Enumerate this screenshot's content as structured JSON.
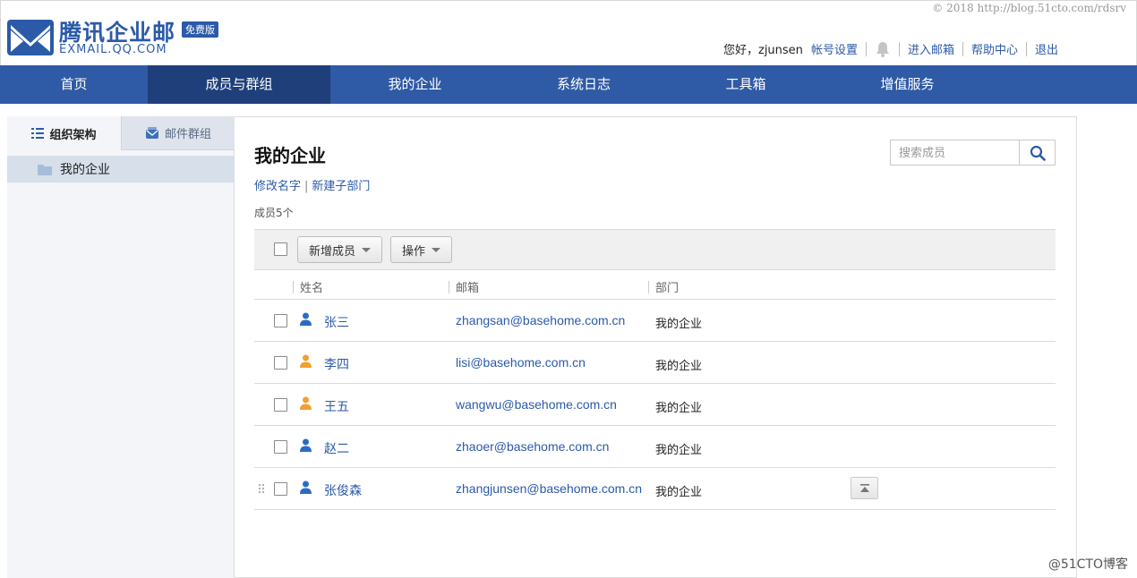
{
  "watermark_top": "© 2018 http://blog.51cto.com/rdsrv",
  "watermark_bottom": "@51CTO博客",
  "brand": {
    "title": "腾讯企业邮",
    "subtitle": "EXMAIL.QQ.COM",
    "badge": "免费版",
    "color": "#2b5aa8"
  },
  "user_bar": {
    "greeting": "您好，zjunsen",
    "account_settings": "帐号设置",
    "enter_mailbox": "进入邮箱",
    "help": "帮助中心",
    "logout": "退出"
  },
  "nav": {
    "items": [
      {
        "label": "首页"
      },
      {
        "label": "成员与群组",
        "active": true
      },
      {
        "label": "我的企业"
      },
      {
        "label": "系统日志"
      },
      {
        "label": "工具箱"
      },
      {
        "label": "增值服务"
      }
    ],
    "color": "#2f5aa5",
    "active_color": "#1e3f7a"
  },
  "sidebar": {
    "tabs": [
      {
        "label": "组织架构",
        "icon": "list-icon",
        "active": true
      },
      {
        "label": "邮件群组",
        "icon": "mail-group-icon",
        "active": false
      }
    ],
    "tree": [
      {
        "label": "我的企业",
        "icon": "folder-icon",
        "selected": true
      }
    ]
  },
  "main": {
    "title": "我的企业",
    "rename": "修改名字",
    "separator": "|",
    "new_sub_department": "新建子部门",
    "member_count": "成员5个",
    "search": {
      "placeholder": "搜索成员",
      "value": ""
    },
    "toolbar": {
      "add_member": "新增成员",
      "operations": "操作"
    },
    "table": {
      "headers": {
        "name": "姓名",
        "email": "邮箱",
        "department": "部门"
      },
      "rows": [
        {
          "name": "张三",
          "email": "zhangsan@basehome.com.cn",
          "department": "我的企业",
          "icon_color": "#2b6cc4"
        },
        {
          "name": "李四",
          "email": "lisi@basehome.com.cn",
          "department": "我的企业",
          "icon_color": "#f0a030"
        },
        {
          "name": "王五",
          "email": "wangwu@basehome.com.cn",
          "department": "我的企业",
          "icon_color": "#f0a030"
        },
        {
          "name": "赵二",
          "email": "zhaoer@basehome.com.cn",
          "department": "我的企业",
          "icon_color": "#2b6cc4"
        },
        {
          "name": "张俊森",
          "email": "zhangjunsen@basehome.com.cn",
          "department": "我的企业",
          "icon_color": "#2b6cc4"
        }
      ]
    }
  }
}
